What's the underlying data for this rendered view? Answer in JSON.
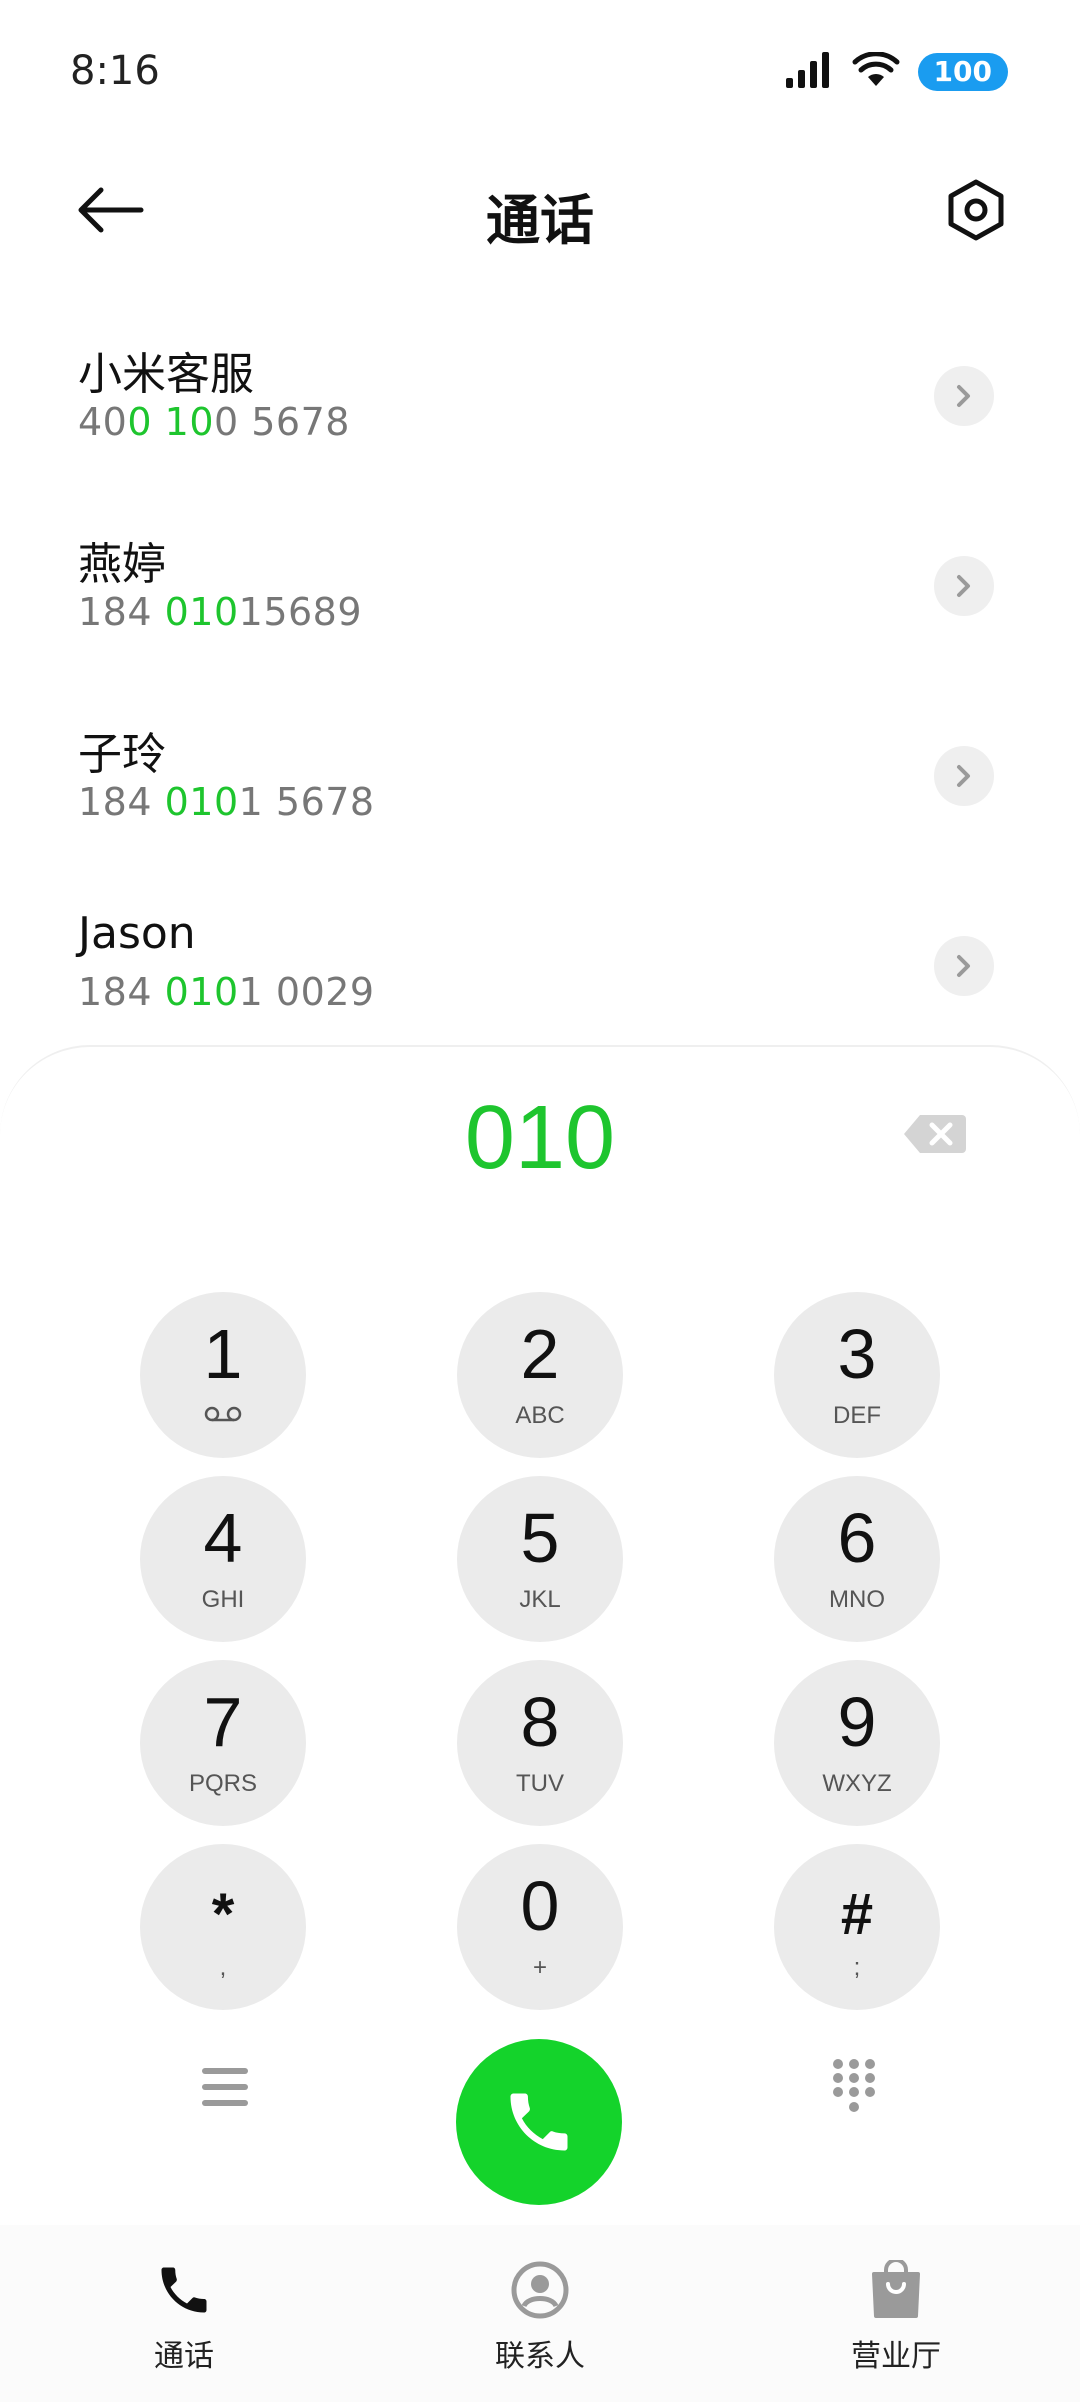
{
  "status_bar": {
    "time": "8:16",
    "battery": "100"
  },
  "header": {
    "title": "通话"
  },
  "contacts": [
    {
      "name": "小米客服",
      "number_parts": [
        "40",
        "0",
        " ",
        "10",
        "0 5678"
      ]
    },
    {
      "name": "燕婷",
      "number_parts": [
        "184 ",
        "010",
        "15689",
        "",
        ""
      ]
    },
    {
      "name": "子玲",
      "number_parts": [
        "184 ",
        "010",
        "1 5678",
        "",
        ""
      ]
    },
    {
      "name": "Jason",
      "number_parts": [
        "184 ",
        "010",
        "1 0029",
        "",
        ""
      ]
    }
  ],
  "dialer": {
    "dialed": "010",
    "keys": [
      {
        "digit": "1",
        "letters": ""
      },
      {
        "digit": "2",
        "letters": "ABC"
      },
      {
        "digit": "3",
        "letters": "DEF"
      },
      {
        "digit": "4",
        "letters": "GHI"
      },
      {
        "digit": "5",
        "letters": "JKL"
      },
      {
        "digit": "6",
        "letters": "MNO"
      },
      {
        "digit": "7",
        "letters": "PQRS"
      },
      {
        "digit": "8",
        "letters": "TUV"
      },
      {
        "digit": "9",
        "letters": "WXYZ"
      },
      {
        "digit": "*",
        "letters": ","
      },
      {
        "digit": "0",
        "letters": "+"
      },
      {
        "digit": "#",
        "letters": ";"
      }
    ]
  },
  "bottom_nav": [
    {
      "label": "通话",
      "icon": "phone-icon",
      "active": true
    },
    {
      "label": "联系人",
      "icon": "contacts-icon",
      "active": false
    },
    {
      "label": "营业厅",
      "icon": "shopping-bag-icon",
      "active": false
    }
  ],
  "colors": {
    "accent_green": "#1ec52e",
    "call_green": "#14d32b",
    "battery_blue": "#1a9cf0"
  }
}
